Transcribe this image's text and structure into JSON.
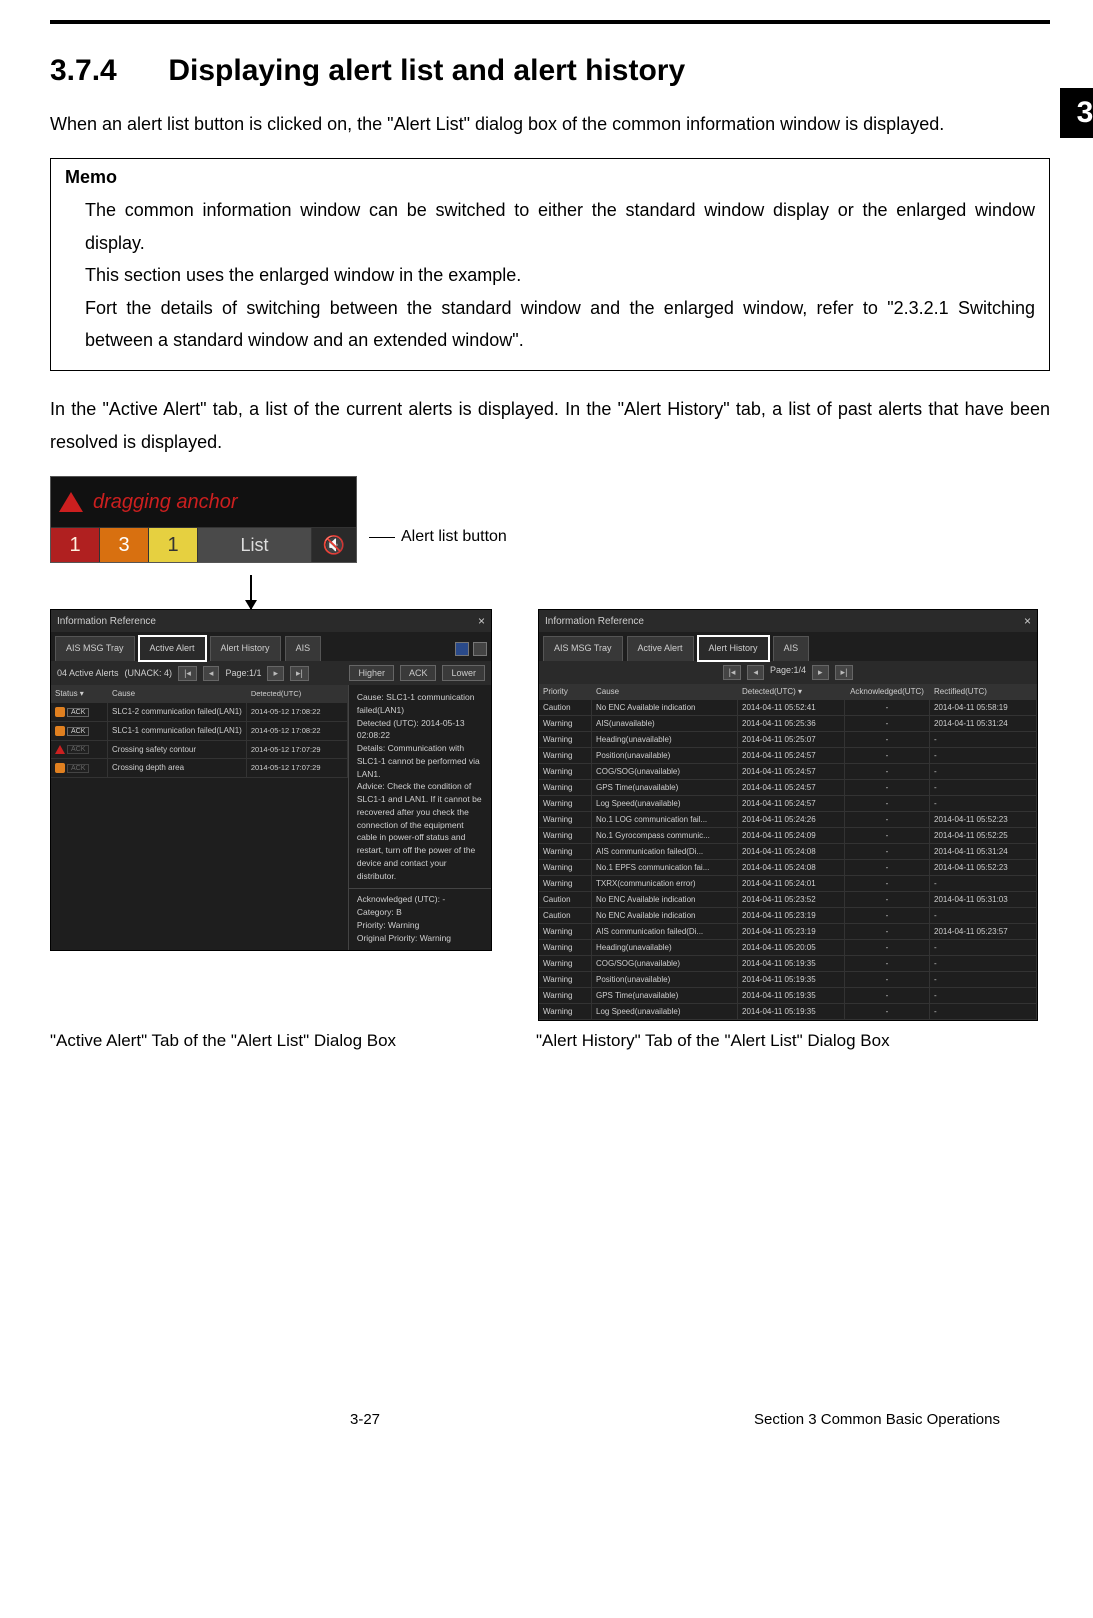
{
  "chapter_tab": "3",
  "heading_num": "3.7.4",
  "heading_text": "Displaying alert list and alert history",
  "intro": "When an alert list button is clicked on, the \"Alert List\" dialog box of the common information window is displayed.",
  "memo_title": "Memo",
  "memo_p1": "The common information window can be switched to either the standard window display or the enlarged window display.",
  "memo_p2": "This section uses the enlarged window in the example.",
  "memo_p3": "Fort the details of switching between the standard window and the enlarged window, refer to \"2.3.2.1 Switching between a standard window and an extended window\".",
  "para2": "In the \"Active Alert\" tab, a list of the current alerts is displayed. In the \"Alert History\" tab, a list of past alerts that have been resolved is displayed.",
  "alert_bar": {
    "dragging": "dragging anchor",
    "n1": "1",
    "n2": "3",
    "n3": "1",
    "list": "List"
  },
  "alert_list_button_label": "Alert list button",
  "active": {
    "title": "Information Reference",
    "tabs": {
      "tray": "AIS MSG\nTray",
      "active": "Active\nAlert",
      "history": "Alert\nHistory",
      "ais": "AIS"
    },
    "statusline": "04 Active Alerts",
    "unack": "(UNACK: 4)",
    "page": "Page:1/1",
    "btn_higher": "Higher",
    "btn_ack": "ACK",
    "btn_lower": "Lower",
    "head_status": "Status",
    "head_cause": "Cause",
    "head_det": "Detected(UTC)",
    "rows": [
      {
        "ack": "ACK",
        "cause": "SLC1-2 communication failed(LAN1)",
        "det": "2014-05-12 17:08:22"
      },
      {
        "ack": "ACK",
        "cause": "SLC1-1 communication failed(LAN1)",
        "det": "2014-05-12 17:08:22"
      },
      {
        "ack": "ACK",
        "cause": "Crossing safety contour",
        "det": "2014-05-12 17:07:29"
      },
      {
        "ack": "ACK",
        "cause": "Crossing depth area",
        "det": "2014-05-12 17:07:29"
      }
    ],
    "detail": {
      "cause_l": "Cause:",
      "cause_v": "SLC1-1 communication failed(LAN1)",
      "det_l": "Detected (UTC):",
      "det_v": "2014-05-13 02:08:22",
      "details_l": "Details:",
      "details_v": "Communication with SLC1-1 cannot be performed via LAN1.",
      "advice_l": "Advice:",
      "advice_v": "Check the condition of SLC1-1 and LAN1. If it cannot be recovered after you check the connection of the equipment cable in power-off status and restart, turn off the power of the device and contact your distributor.",
      "ack_l": "Acknowledged (UTC):",
      "ack_v": "-",
      "cat_l": "Category:",
      "cat_v": "B",
      "pri_l": "Priority:",
      "pri_v": "Warning",
      "orig_l": "Original Priority:",
      "orig_v": "Warning"
    }
  },
  "history": {
    "title": "Information Reference",
    "tabs": {
      "tray": "AIS MSG\nTray",
      "active": "Active\nAlert",
      "history": "Alert\nHistory",
      "ais": "AIS"
    },
    "page": "Page:1/4",
    "head_pri": "Priority",
    "head_cause": "Cause",
    "head_det": "Detected(UTC)",
    "head_ack": "Acknowledged(UTC)",
    "head_rec": "Rectified(UTC)",
    "rows": [
      {
        "pri": "Caution",
        "cause": "No ENC Available indication",
        "det": "2014-04-11 05:52:41",
        "ack": "-",
        "rec": "2014-04-11 05:58:19"
      },
      {
        "pri": "Warning",
        "cause": "AIS(unavailable)",
        "det": "2014-04-11 05:25:36",
        "ack": "-",
        "rec": "2014-04-11 05:31:24"
      },
      {
        "pri": "Warning",
        "cause": "Heading(unavailable)",
        "det": "2014-04-11 05:25:07",
        "ack": "-",
        "rec": "-"
      },
      {
        "pri": "Warning",
        "cause": "Position(unavailable)",
        "det": "2014-04-11 05:24:57",
        "ack": "-",
        "rec": "-"
      },
      {
        "pri": "Warning",
        "cause": "COG/SOG(unavailable)",
        "det": "2014-04-11 05:24:57",
        "ack": "-",
        "rec": "-"
      },
      {
        "pri": "Warning",
        "cause": "GPS Time(unavailable)",
        "det": "2014-04-11 05:24:57",
        "ack": "-",
        "rec": "-"
      },
      {
        "pri": "Warning",
        "cause": "Log Speed(unavailable)",
        "det": "2014-04-11 05:24:57",
        "ack": "-",
        "rec": "-"
      },
      {
        "pri": "Warning",
        "cause": "No.1 LOG communication fail...",
        "det": "2014-04-11 05:24:26",
        "ack": "-",
        "rec": "2014-04-11 05:52:23"
      },
      {
        "pri": "Warning",
        "cause": "No.1 Gyrocompass communic...",
        "det": "2014-04-11 05:24:09",
        "ack": "-",
        "rec": "2014-04-11 05:52:25"
      },
      {
        "pri": "Warning",
        "cause": "AIS communication failed(Di...",
        "det": "2014-04-11 05:24:08",
        "ack": "-",
        "rec": "2014-04-11 05:31:24"
      },
      {
        "pri": "Warning",
        "cause": "No.1 EPFS communication fai...",
        "det": "2014-04-11 05:24:08",
        "ack": "-",
        "rec": "2014-04-11 05:52:23"
      },
      {
        "pri": "Warning",
        "cause": "TXRX(communication error)",
        "det": "2014-04-11 05:24:01",
        "ack": "-",
        "rec": "-"
      },
      {
        "pri": "Caution",
        "cause": "No ENC Available indication",
        "det": "2014-04-11 05:23:52",
        "ack": "-",
        "rec": "2014-04-11 05:31:03"
      },
      {
        "pri": "Caution",
        "cause": "No ENC Available indication",
        "det": "2014-04-11 05:23:19",
        "ack": "-",
        "rec": "-"
      },
      {
        "pri": "Warning",
        "cause": "AIS communication failed(Di...",
        "det": "2014-04-11 05:23:19",
        "ack": "-",
        "rec": "2014-04-11 05:23:57"
      },
      {
        "pri": "Warning",
        "cause": "Heading(unavailable)",
        "det": "2014-04-11 05:20:05",
        "ack": "-",
        "rec": "-"
      },
      {
        "pri": "Warning",
        "cause": "COG/SOG(unavailable)",
        "det": "2014-04-11 05:19:35",
        "ack": "-",
        "rec": "-"
      },
      {
        "pri": "Warning",
        "cause": "Position(unavailable)",
        "det": "2014-04-11 05:19:35",
        "ack": "-",
        "rec": "-"
      },
      {
        "pri": "Warning",
        "cause": "GPS Time(unavailable)",
        "det": "2014-04-11 05:19:35",
        "ack": "-",
        "rec": "-"
      },
      {
        "pri": "Warning",
        "cause": "Log Speed(unavailable)",
        "det": "2014-04-11 05:19:35",
        "ack": "-",
        "rec": "-"
      }
    ]
  },
  "caption_left": "\"Active Alert\" Tab of the \"Alert List\" Dialog Box",
  "caption_right": "\"Alert History\" Tab of the \"Alert List\" Dialog Box",
  "footer_page": "3-27",
  "footer_section": "Section 3    Common Basic Operations"
}
